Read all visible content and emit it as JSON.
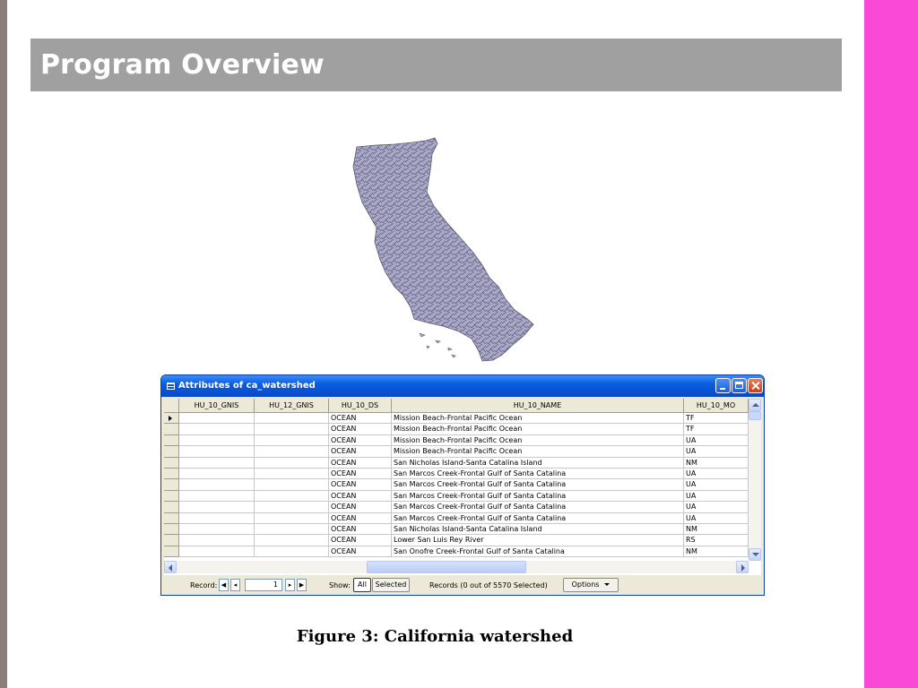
{
  "slide": {
    "title": "Program Overview",
    "caption": "Figure 3: California watershed",
    "colors": {
      "banner": "#a0a0a0",
      "left_bar": "#8c7f7a",
      "right_bar": "#f949d6",
      "map_fill": "#a9a8c8",
      "map_lines": "#5a5870"
    }
  },
  "window": {
    "title": "Attributes of ca_watershed",
    "icons": {
      "title": "table-icon",
      "minimize": "minimize-icon",
      "maximize": "maximize-icon",
      "close": "close-icon"
    },
    "columns": [
      "HU_10_GNIS",
      "HU_12_GNIS",
      "HU_10_DS",
      "HU_10_NAME",
      "HU_10_MO"
    ],
    "rows": [
      {
        "hu10gnis": "",
        "hu12gnis": "",
        "ds": "OCEAN",
        "name": "Mission Beach-Frontal Pacific Ocean",
        "mo": "TF"
      },
      {
        "hu10gnis": "",
        "hu12gnis": "",
        "ds": "OCEAN",
        "name": "Mission Beach-Frontal Pacific Ocean",
        "mo": "TF"
      },
      {
        "hu10gnis": "",
        "hu12gnis": "",
        "ds": "OCEAN",
        "name": "Mission Beach-Frontal Pacific Ocean",
        "mo": "UA"
      },
      {
        "hu10gnis": "",
        "hu12gnis": "",
        "ds": "OCEAN",
        "name": "Mission Beach-Frontal Pacific Ocean",
        "mo": "UA"
      },
      {
        "hu10gnis": "",
        "hu12gnis": "",
        "ds": "OCEAN",
        "name": "San Nicholas Island-Santa Catalina Island",
        "mo": "NM"
      },
      {
        "hu10gnis": "",
        "hu12gnis": "",
        "ds": "OCEAN",
        "name": "San Marcos Creek-Frontal Gulf of Santa Catalina",
        "mo": "UA"
      },
      {
        "hu10gnis": "",
        "hu12gnis": "",
        "ds": "OCEAN",
        "name": "San Marcos Creek-Frontal Gulf of Santa Catalina",
        "mo": "UA"
      },
      {
        "hu10gnis": "",
        "hu12gnis": "",
        "ds": "OCEAN",
        "name": "San Marcos Creek-Frontal Gulf of Santa Catalina",
        "mo": "UA"
      },
      {
        "hu10gnis": "",
        "hu12gnis": "",
        "ds": "OCEAN",
        "name": "San Marcos Creek-Frontal Gulf of Santa Catalina",
        "mo": "UA"
      },
      {
        "hu10gnis": "",
        "hu12gnis": "",
        "ds": "OCEAN",
        "name": "San Marcos Creek-Frontal Gulf of Santa Catalina",
        "mo": "UA"
      },
      {
        "hu10gnis": "",
        "hu12gnis": "",
        "ds": "OCEAN",
        "name": "San Nicholas Island-Santa Catalina Island",
        "mo": "NM"
      },
      {
        "hu10gnis": "",
        "hu12gnis": "",
        "ds": "OCEAN",
        "name": "Lower San Luis Rey River",
        "mo": "RS"
      },
      {
        "hu10gnis": "",
        "hu12gnis": "",
        "ds": "OCEAN",
        "name": "San Onofre Creek-Frontal Gulf of Santa Catalina",
        "mo": "NM"
      }
    ],
    "status": {
      "record_label": "Record:",
      "record_value": "1",
      "show_label": "Show:",
      "show_all": "All",
      "show_selected": "Selected",
      "records_text": "Records (0 out of 5570 Selected)",
      "options_label": "Options",
      "nav_icons": [
        "first-record-icon",
        "prev-record-icon",
        "next-record-icon",
        "last-record-icon"
      ]
    }
  }
}
